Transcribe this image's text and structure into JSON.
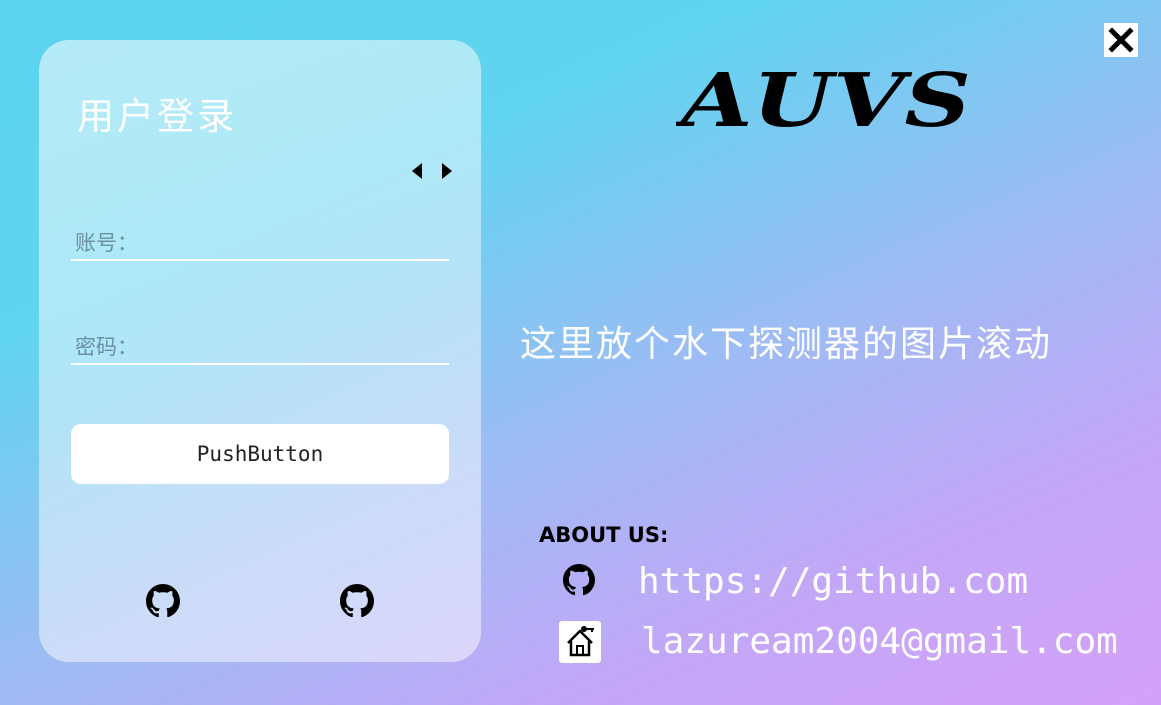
{
  "window": {
    "close_icon": "close-icon"
  },
  "login": {
    "title": "用户登录",
    "prev_icon": "caret-left-icon",
    "next_icon": "caret-right-icon",
    "account_label": "账号：",
    "account_value": "",
    "password_label": "密码：",
    "password_value": "",
    "push_button_label": "PushButton",
    "github_icons": [
      "github-icon",
      "github-icon"
    ]
  },
  "brand": {
    "logo_text": "AUVS"
  },
  "main": {
    "placeholder_text": "这里放个水下探测器的图片滚动"
  },
  "about": {
    "title": "ABOUT US:",
    "github_url": "https://github.com",
    "email": "lazuream2004@gmail.com",
    "github_icon": "github-icon",
    "email_icon": "home-icon"
  },
  "colors": {
    "gradient_start": "#5ad3ee",
    "gradient_end": "#d4a1f9",
    "text_light": "#ffffff",
    "text_dark": "#000000"
  }
}
